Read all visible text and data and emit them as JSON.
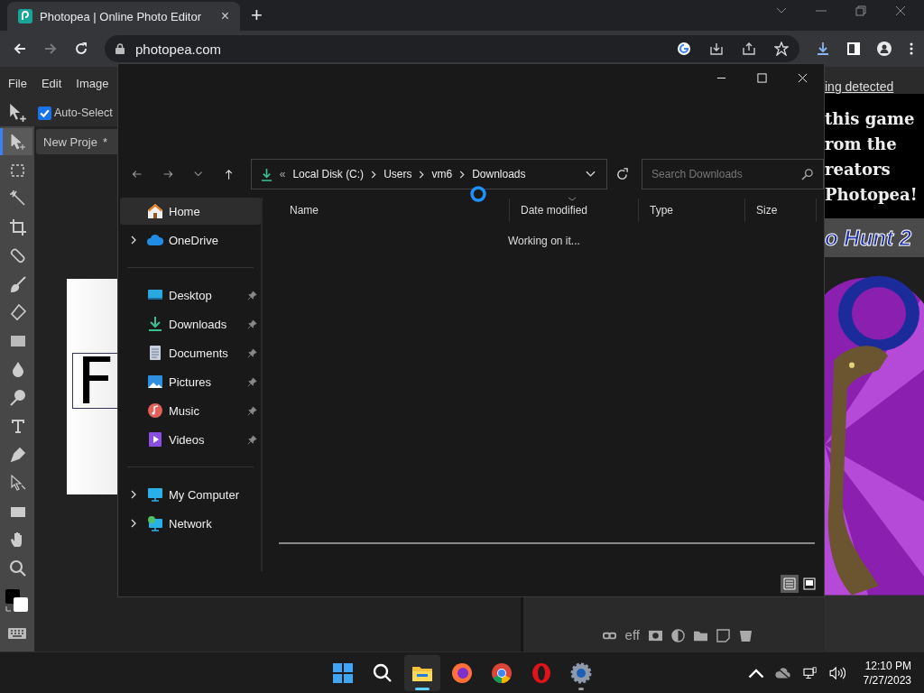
{
  "browser": {
    "tab_title": "Photopea | Online Photo Editor",
    "tab_close": "×",
    "new_tab": "+",
    "url": "photopea.com"
  },
  "photopea": {
    "menu": [
      "File",
      "Edit",
      "Image"
    ],
    "auto_select": {
      "label": "Auto-Select",
      "checked": true
    },
    "doc_tab": {
      "title": "New Proje",
      "marker": "*"
    },
    "canvas_text": "F",
    "tools": [
      {
        "kind": "move",
        "selected": true
      },
      {
        "kind": "marquee",
        "selected": false
      },
      {
        "kind": "wand",
        "selected": false
      },
      {
        "kind": "crop",
        "selected": false
      },
      {
        "kind": "heal",
        "selected": false
      },
      {
        "kind": "brush",
        "selected": false
      },
      {
        "kind": "eraser",
        "selected": false
      },
      {
        "kind": "gradient",
        "selected": false
      },
      {
        "kind": "blur",
        "selected": false
      },
      {
        "kind": "dodge",
        "selected": false
      },
      {
        "kind": "type",
        "selected": false
      },
      {
        "kind": "pen",
        "selected": false
      },
      {
        "kind": "path",
        "selected": false
      },
      {
        "kind": "shape",
        "selected": false
      },
      {
        "kind": "hand",
        "selected": false
      },
      {
        "kind": "zoom",
        "selected": false
      }
    ],
    "layer_effects_label": "eff",
    "ad": {
      "link": "ing detected",
      "lines": [
        "this game",
        "rom the",
        "reators",
        "Photopea!"
      ],
      "game_title": "o Hunt 2"
    }
  },
  "explorer": {
    "path": [
      "Local Disk (C:)",
      "Users",
      "vm6",
      "Downloads"
    ],
    "path_overflow": "«",
    "search_placeholder": "Search Downloads",
    "nav_groups": [
      [
        {
          "label": "Home",
          "kind": "home",
          "selected": true,
          "expandable": false,
          "pinned": false
        },
        {
          "label": "OneDrive",
          "kind": "cloud",
          "selected": false,
          "expandable": true,
          "pinned": false
        }
      ],
      [
        {
          "label": "Desktop",
          "kind": "desktop",
          "selected": false,
          "expandable": false,
          "pinned": true
        },
        {
          "label": "Downloads",
          "kind": "download",
          "selected": false,
          "expandable": false,
          "pinned": true
        },
        {
          "label": "Documents",
          "kind": "documents",
          "selected": false,
          "expandable": false,
          "pinned": true
        },
        {
          "label": "Pictures",
          "kind": "pictures",
          "selected": false,
          "expandable": false,
          "pinned": true
        },
        {
          "label": "Music",
          "kind": "music",
          "selected": false,
          "expandable": false,
          "pinned": true
        },
        {
          "label": "Videos",
          "kind": "videos",
          "selected": false,
          "expandable": false,
          "pinned": true
        }
      ],
      [
        {
          "label": "My Computer",
          "kind": "computer",
          "selected": false,
          "expandable": true,
          "pinned": false
        },
        {
          "label": "Network",
          "kind": "network",
          "selected": false,
          "expandable": true,
          "pinned": false
        }
      ]
    ],
    "columns": [
      {
        "label": "Name",
        "sorted": false
      },
      {
        "label": "Date modified",
        "sorted": true
      },
      {
        "label": "Type",
        "sorted": false
      },
      {
        "label": "Size",
        "sorted": false
      }
    ],
    "status": "Working on it...",
    "views": [
      {
        "kind": "details",
        "selected": true
      },
      {
        "kind": "tiles",
        "selected": false
      }
    ]
  },
  "taskbar": {
    "apps": [
      {
        "kind": "start",
        "active": false,
        "running": false
      },
      {
        "kind": "search",
        "active": false,
        "running": false
      },
      {
        "kind": "explorer",
        "active": true,
        "running": true
      },
      {
        "kind": "firefox",
        "active": false,
        "running": false
      },
      {
        "kind": "chrome",
        "active": false,
        "running": false
      },
      {
        "kind": "opera",
        "active": false,
        "running": false
      },
      {
        "kind": "settings",
        "active": false,
        "running": true
      }
    ],
    "time": "12:10 PM",
    "date": "7/27/2023"
  }
}
